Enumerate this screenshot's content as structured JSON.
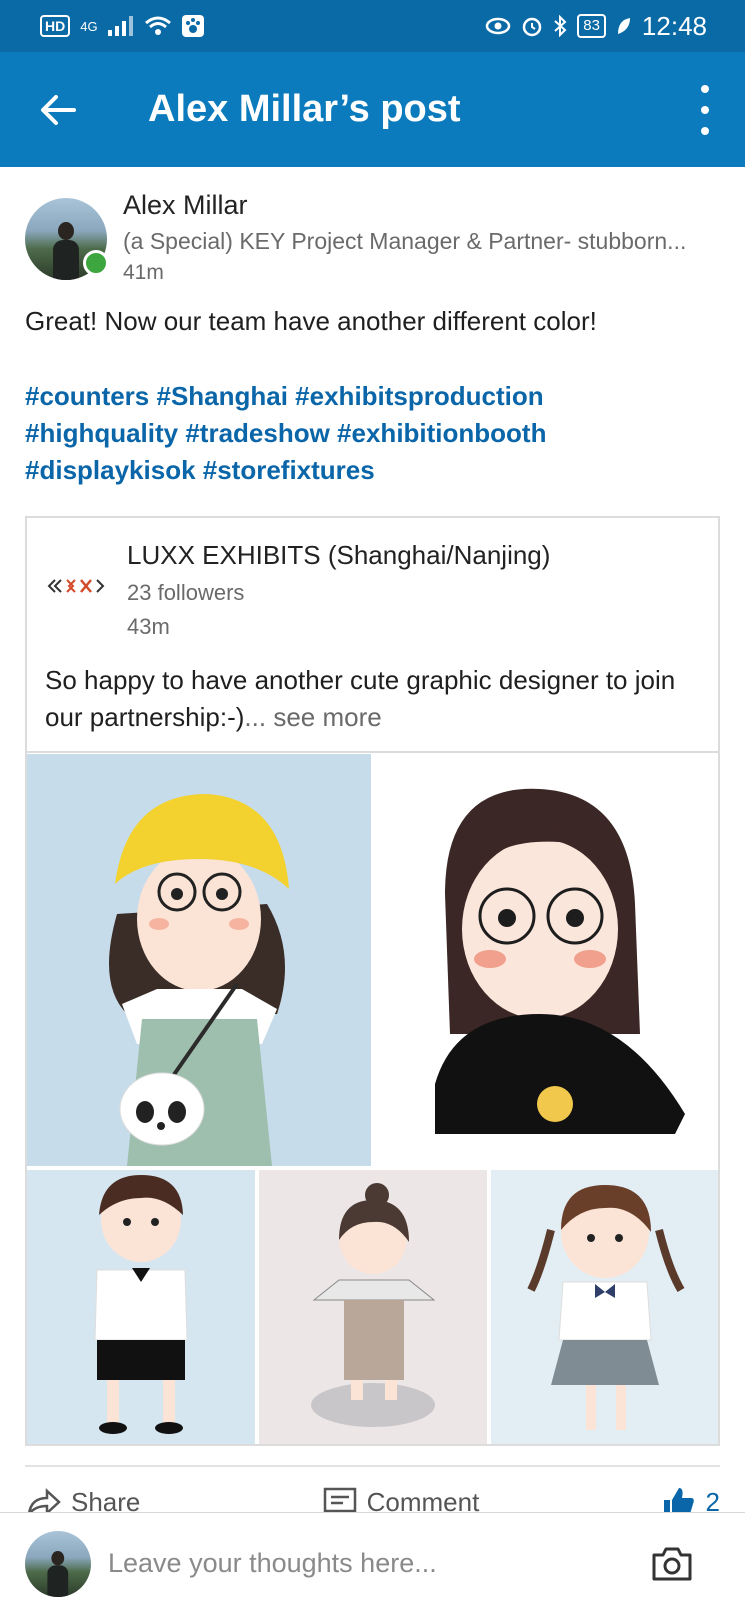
{
  "status_bar": {
    "hd": "HD",
    "network": "4G",
    "battery": "83",
    "time": "12:48"
  },
  "app_bar": {
    "title": "Alex Millar’s post",
    "back_icon": "arrow-left-icon",
    "more_icon": "more-vertical-icon"
  },
  "post": {
    "author_name": "Alex Millar",
    "author_title": "(a Special) KEY Project Manager & Partner- stubborn...",
    "time": "41m",
    "text": "Great! Now our team have another different color!",
    "hashtags": [
      "#counters #Shanghai #exhibitsproduction",
      "#highquality #tradeshow #exhibitionbooth",
      "#displaykisok #storefixtures"
    ]
  },
  "shared": {
    "company": "LUXX EXHIBITS (Shanghai/Nanjing)",
    "followers": "23 followers",
    "time": "43m",
    "text": "So happy to have another cute graphic designer to join our partnership:-)",
    "see_more": "... see more"
  },
  "actions": {
    "share": "Share",
    "comment": "Comment",
    "likes": "2"
  },
  "composer": {
    "placeholder": "Leave your thoughts here...",
    "camera_icon": "camera-icon"
  },
  "colors": {
    "status_bar": "#0a6aa6",
    "app_bar": "#0b7bbd",
    "hashtag": "#0a66a8",
    "online": "#3ea63f"
  }
}
